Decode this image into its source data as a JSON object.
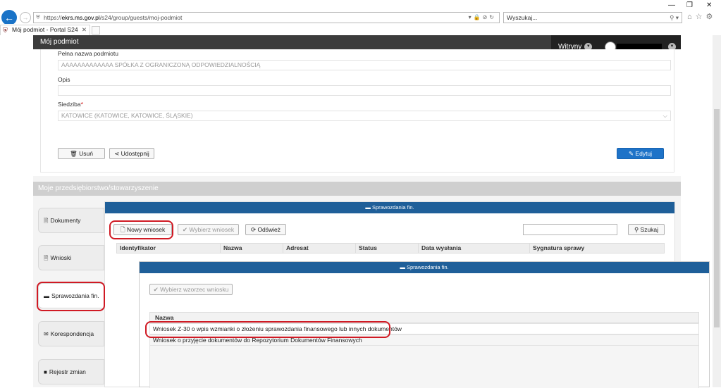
{
  "browser": {
    "url_prefix": "https://",
    "url_host": "ekrs.ms.gov.pl",
    "url_path": "/s24/group/guests/moj-podmiot",
    "search_placeholder": "Wyszukaj...",
    "tab_title": "Mój podmiot - Portal S24"
  },
  "header": {
    "portlet_title": "Mój podmiot",
    "sites_label": "Witryny"
  },
  "form": {
    "name_label": "Pełna nazwa podmiotu",
    "name_value": "AAAAAAAAAAAAA SPÓŁKA Z OGRANICZONĄ ODPOWIEDZIALNOŚCIĄ",
    "desc_label": "Opis",
    "desc_value": "",
    "seat_label": "Siedziba",
    "seat_required": "*",
    "seat_value": "KATOWICE (KATOWICE, KATOWICE, ŚLĄSKIE)",
    "delete_label": "Usuń",
    "share_label": "Udostępnij",
    "edit_label": "Edytuj"
  },
  "section": {
    "title": "Moje przedsiębiorstwo/stowarzyszenie"
  },
  "side_tabs": [
    {
      "label": "Dokumenty",
      "icon": "document-icon"
    },
    {
      "label": "Wnioski",
      "icon": "document-icon"
    },
    {
      "label": "Sprawozdania fin.",
      "icon": "folder-icon"
    },
    {
      "label": "Korespondencja",
      "icon": "envelope-icon"
    },
    {
      "label": "Rejestr zmian",
      "icon": "briefcase-icon"
    }
  ],
  "panel": {
    "title": "Sprawozdania fin.",
    "new_label": "Nowy wniosek",
    "choose_label": "Wybierz wniosek",
    "refresh_label": "Odśwież",
    "search_value": "",
    "search_label": "Szukaj",
    "columns": [
      "Identyfikator",
      "Nazwa",
      "Adresat",
      "Status",
      "Data wysłania",
      "Sygnatura sprawy"
    ]
  },
  "dialog": {
    "title": "Sprawozdania fin.",
    "choose_template_label": "Wybierz wzorzec wniosku",
    "column": "Nazwa",
    "rows": [
      "Wniosek Z-30 o wpis wzmianki o złożeniu sprawozdania finansowego lub innych dokumentów",
      "Wniosek o przyjęcie dokumentów do Repozytorium Dokumentów Finansowych"
    ]
  },
  "colors": {
    "accent": "#1e73c8",
    "panel_header": "#1f5f99",
    "highlight": "#d01a24"
  }
}
